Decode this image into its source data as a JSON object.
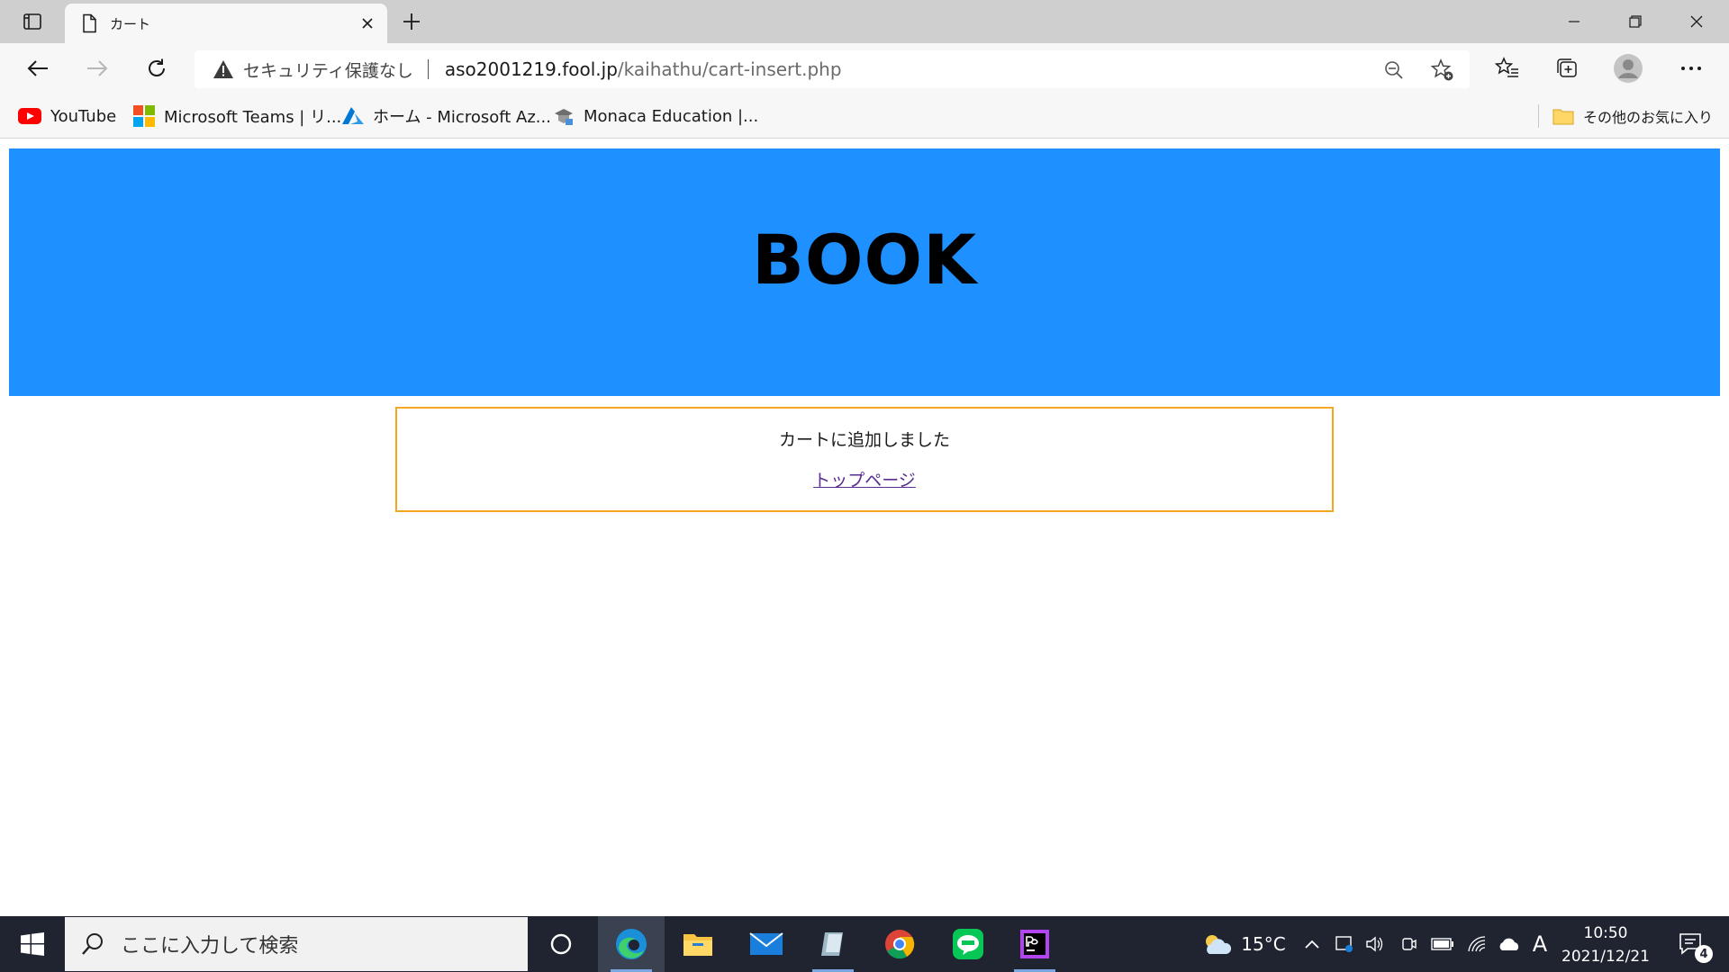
{
  "browser": {
    "tab_title": "カート",
    "security_text": "セキュリティ保護なし",
    "url_host": "aso2001219.fool.jp",
    "url_path": "/kaihathu/cart-insert.php"
  },
  "favorites": {
    "items": [
      {
        "label": "YouTube",
        "icon": "youtube-icon"
      },
      {
        "label": "Microsoft Teams | リ...",
        "icon": "microsoft-icon"
      },
      {
        "label": "ホーム - Microsoft Az...",
        "icon": "azure-icon"
      },
      {
        "label": "Monaca Education |...",
        "icon": "monaca-icon"
      }
    ],
    "other_label": "その他のお気に入り"
  },
  "page": {
    "header_title": "BOOK",
    "message": "カートに追加しました",
    "top_link": "トップページ",
    "colors": {
      "header_bg": "#1e90ff",
      "box_border": "#f5a623",
      "link": "#5a2d91"
    }
  },
  "taskbar": {
    "search_placeholder": "ここに入力して検索",
    "weather": "15°C",
    "ime": "A",
    "time": "10:50",
    "date": "2021/12/21",
    "notifications": "4"
  }
}
